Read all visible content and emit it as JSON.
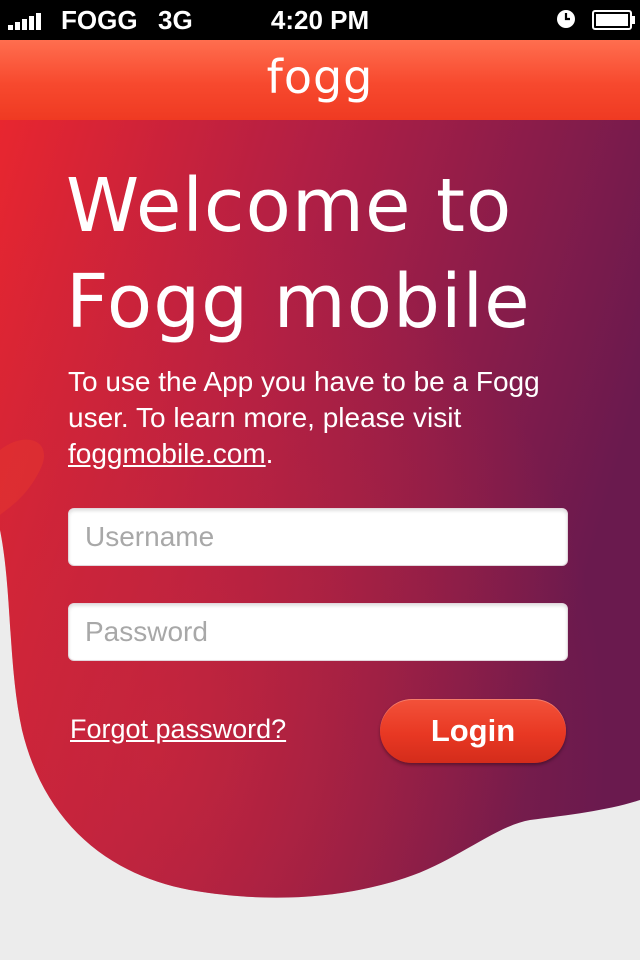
{
  "status_bar": {
    "carrier": "FOGG",
    "network": "3G",
    "time": "4:20 PM"
  },
  "nav": {
    "logo_text": "fogg"
  },
  "welcome": {
    "line1": "Welcome to",
    "line2": "Fogg mobile"
  },
  "intro": {
    "text": "To use the App you have to be a Fogg user. To learn more, please visit ",
    "link": "foggmobile.com",
    "end": "."
  },
  "form": {
    "username_placeholder": "Username",
    "password_placeholder": "Password",
    "username_value": "",
    "password_value": "",
    "forgot_label": "Forgot password?",
    "login_label": "Login"
  },
  "colors": {
    "brand": "#f7492e",
    "splash_start": "#e52a33",
    "splash_end": "#6a1a4e",
    "background": "#ececec"
  }
}
